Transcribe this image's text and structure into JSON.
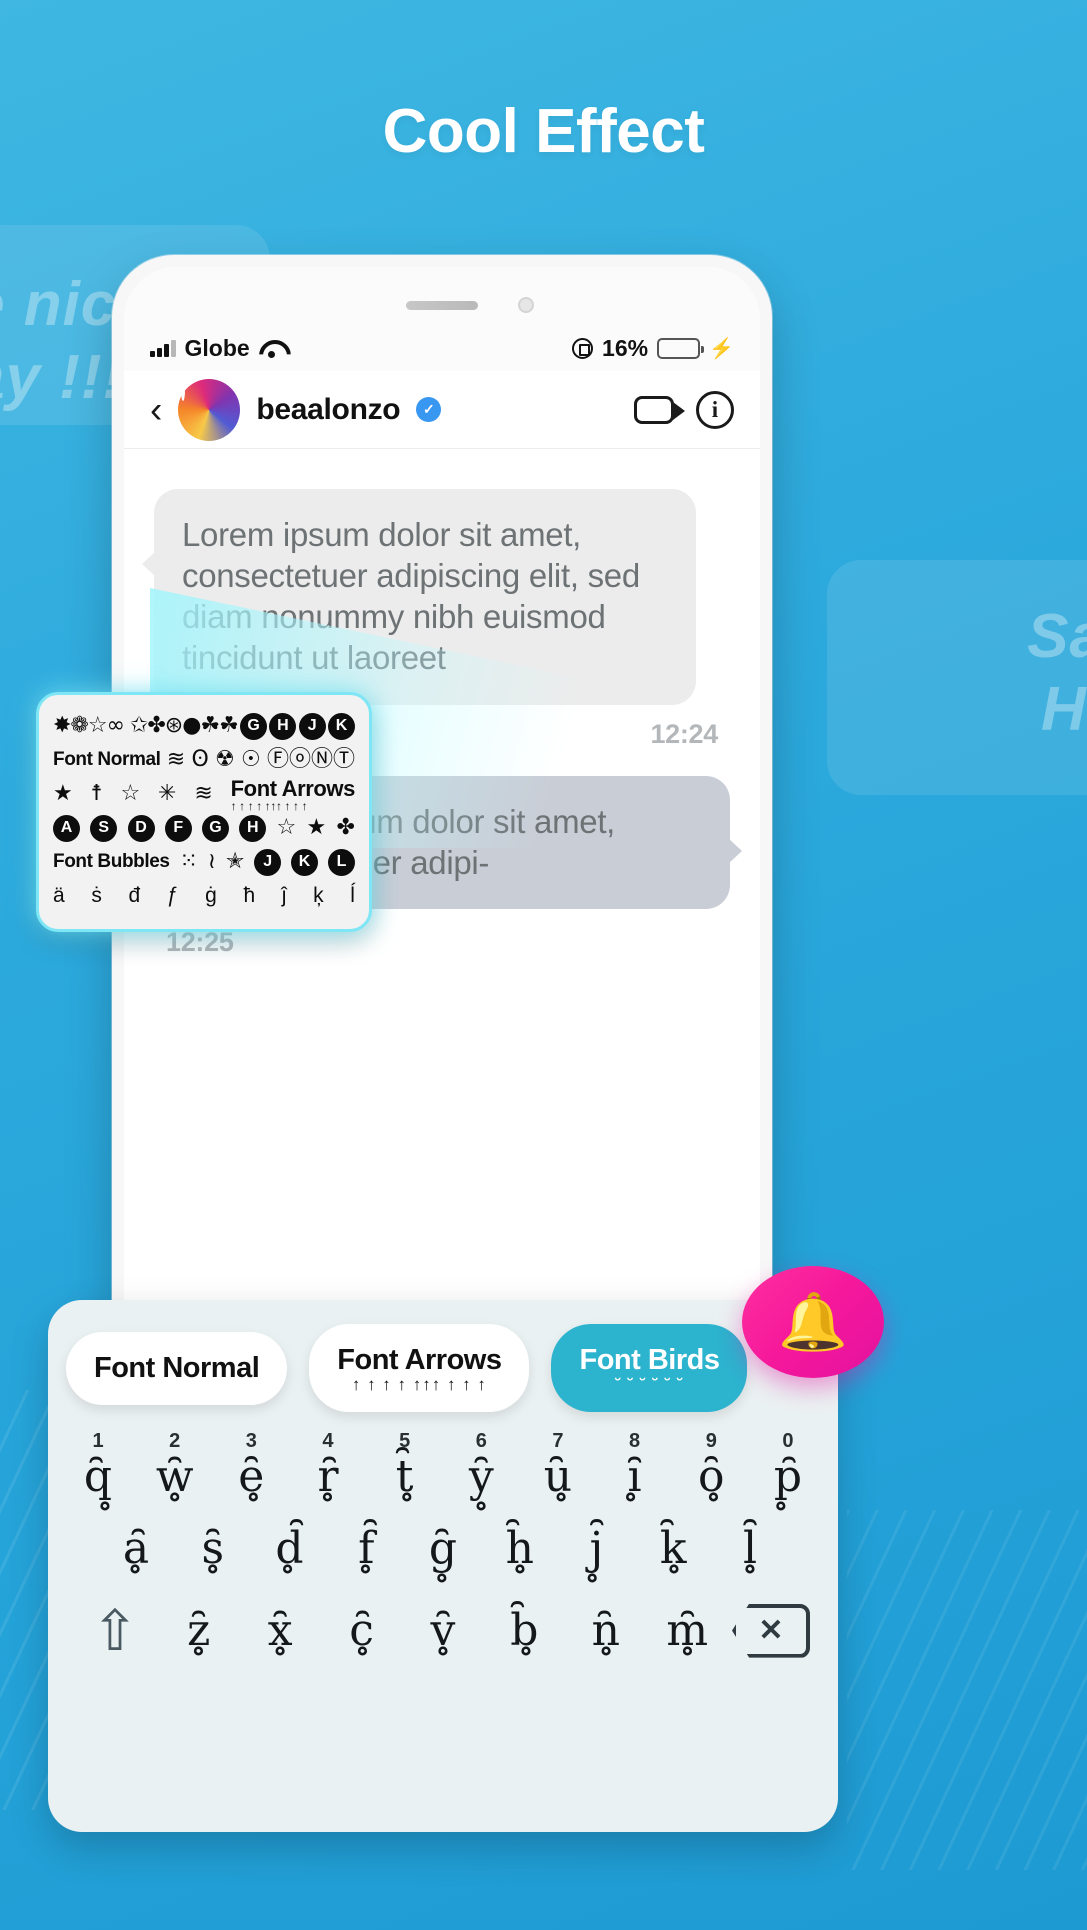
{
  "headline": "Cool Effect",
  "background": {
    "accent": "#2eaadd",
    "ghost_text_1": "e nic\nay !!!",
    "ghost_text_2": "Sa\nHi"
  },
  "phone": {
    "statusbar": {
      "carrier": "Globe",
      "signal_icon": "signal-bars-icon",
      "wifi_icon": "wifi-icon",
      "lock_icon": "rotation-lock-icon",
      "battery_percent": "16%",
      "battery_fill_color": "#f7c324",
      "charging_icon": "⚡"
    },
    "chat_header": {
      "back_icon": "‹",
      "avatar_name": "avatar",
      "username": "beaalonzo",
      "verified_icon": "✓",
      "video_icon": "video-camera-icon",
      "info_icon": "i"
    },
    "messages": [
      {
        "direction": "incoming",
        "text": "Lorem ipsum dolor sit amet, consectetuer adipiscing elit, sed diam nonummy nibh euismod tincidunt ut laoreet",
        "time": "12:24",
        "bubble_color": "#ececec"
      },
      {
        "direction": "outgoing",
        "text": "Lorem ipsum dolor sit amet, consectetuer adipi-",
        "time": "12:25",
        "bubble_color": "#c9cdd6"
      }
    ]
  },
  "font_popup": {
    "border_color": "#7fe6f5",
    "rows": [
      {
        "cells": [
          {
            "type": "symbols",
            "text": "✸❁☆∞ ✩✤⊛●☘☘"
          },
          {
            "type": "circle",
            "text": "G"
          },
          {
            "type": "circle",
            "text": "H"
          },
          {
            "type": "circle",
            "text": "J"
          },
          {
            "type": "circle",
            "text": "K"
          }
        ]
      },
      {
        "cells": [
          {
            "type": "label",
            "text": "Font Normal"
          },
          {
            "type": "symbol",
            "text": "≋"
          },
          {
            "type": "symbol",
            "text": "ʘ"
          },
          {
            "type": "symbol",
            "text": "☢"
          },
          {
            "type": "symbol",
            "text": "☉"
          },
          {
            "type": "symbol",
            "text": "ⒻⓞⓃⓉ"
          }
        ]
      },
      {
        "cells": [
          {
            "type": "symbol",
            "text": "★"
          },
          {
            "type": "symbol",
            "text": "☨"
          },
          {
            "type": "symbol",
            "text": "☆"
          },
          {
            "type": "symbol",
            "text": "✳"
          },
          {
            "type": "symbol",
            "text": "≋"
          },
          {
            "type": "label-arrows",
            "text": "Font Arrows",
            "deco": "↑ ↑ ↑ ↑  ↑↑↑ ↑  ↑  ↑"
          }
        ]
      },
      {
        "cells": [
          {
            "type": "circle",
            "text": "A"
          },
          {
            "type": "circle",
            "text": "S"
          },
          {
            "type": "circle",
            "text": "D"
          },
          {
            "type": "circle",
            "text": "F"
          },
          {
            "type": "circle",
            "text": "G"
          },
          {
            "type": "circle",
            "text": "H"
          },
          {
            "type": "symbol",
            "text": "☆"
          },
          {
            "type": "symbol",
            "text": "★"
          },
          {
            "type": "symbol",
            "text": "✤"
          }
        ]
      },
      {
        "cells": [
          {
            "type": "label",
            "text": "Font Bubbles"
          },
          {
            "type": "symbol",
            "text": "⁙"
          },
          {
            "type": "symbol",
            "text": "≀"
          },
          {
            "type": "symbol",
            "text": "✭"
          },
          {
            "type": "circle",
            "text": "J"
          },
          {
            "type": "circle",
            "text": "K"
          },
          {
            "type": "circle",
            "text": "L"
          }
        ]
      },
      {
        "cells": [
          {
            "type": "dec",
            "text": "ä"
          },
          {
            "type": "dec",
            "text": "ṡ"
          },
          {
            "type": "dec",
            "text": "đ"
          },
          {
            "type": "dec",
            "text": "ƒ"
          },
          {
            "type": "dec",
            "text": "ġ"
          },
          {
            "type": "dec",
            "text": "ħ"
          },
          {
            "type": "dec",
            "text": "ĵ"
          },
          {
            "type": "dec",
            "text": "ķ"
          },
          {
            "type": "dec",
            "text": "ĺ"
          }
        ]
      }
    ]
  },
  "keyboard": {
    "sheet_bg": "#eaf1f2",
    "tabs": [
      {
        "label": "Font Normal",
        "deco": "",
        "active": false
      },
      {
        "label": "Font Arrows",
        "deco": "↑ ↑ ↑ ↑  ↑↑↑ ↑  ↑  ↑",
        "active": false
      },
      {
        "label": "Font Birds",
        "deco": "˘ ˘ ˘  ˘ ˘ ˘",
        "active": true
      }
    ],
    "active_tab_color": "#2cb3ce",
    "bell_badge": {
      "icon": "🔔",
      "color": "#f5189b"
    },
    "row1": [
      {
        "num": "1",
        "glyph": "q̥̑"
      },
      {
        "num": "2",
        "glyph": "w̥̑"
      },
      {
        "num": "3",
        "glyph": "ȇ̥"
      },
      {
        "num": "4",
        "glyph": "ȓ̥"
      },
      {
        "num": "5",
        "glyph": "t̥̑"
      },
      {
        "num": "6",
        "glyph": "y̥̑"
      },
      {
        "num": "7",
        "glyph": "ȗ̥"
      },
      {
        "num": "8",
        "glyph": "ȋ̥"
      },
      {
        "num": "9",
        "glyph": "ȏ̥"
      },
      {
        "num": "0",
        "glyph": "p̥̑"
      }
    ],
    "row2": [
      {
        "glyph": "ḁ̑"
      },
      {
        "glyph": "s̥̑"
      },
      {
        "glyph": "d̥̑"
      },
      {
        "glyph": "f̥̑"
      },
      {
        "glyph": "g̥̑"
      },
      {
        "glyph": "h̥̑"
      },
      {
        "glyph": "j̥̑"
      },
      {
        "glyph": "k̥̑"
      },
      {
        "glyph": "l̥̑"
      }
    ],
    "row3": [
      {
        "glyph": "z̥̑"
      },
      {
        "glyph": "x̥̑"
      },
      {
        "glyph": "c̥̑"
      },
      {
        "glyph": "v̥̑"
      },
      {
        "glyph": "b̥̑"
      },
      {
        "glyph": "n̥̑"
      },
      {
        "glyph": "m̥̑"
      }
    ],
    "shift_icon": "⇧",
    "backspace_icon": "✕"
  }
}
